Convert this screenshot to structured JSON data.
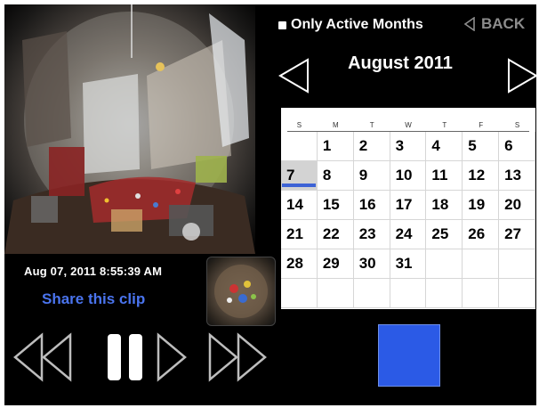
{
  "video": {
    "timestamp": "Aug 07, 2011 8:55:39 AM",
    "share_label": "Share this clip"
  },
  "controls": {
    "rewind": "rewind-icon",
    "pause": "pause-icon",
    "play": "play-icon",
    "fast_forward": "fast-forward-icon"
  },
  "header": {
    "active_months_label": "Only Active Months",
    "back_label": "BACK"
  },
  "calendar": {
    "month_title": "August 2011",
    "weekdays": [
      "S",
      "M",
      "T",
      "W",
      "T",
      "F",
      "S"
    ],
    "first_weekday_index": 1,
    "days_in_month": 31,
    "selected_day": 7
  },
  "colors": {
    "accent_blue": "#2b5ae6",
    "share_link": "#4a74ee",
    "selected_bar": "#3d63d6",
    "back_gray": "#8d8d8d"
  }
}
